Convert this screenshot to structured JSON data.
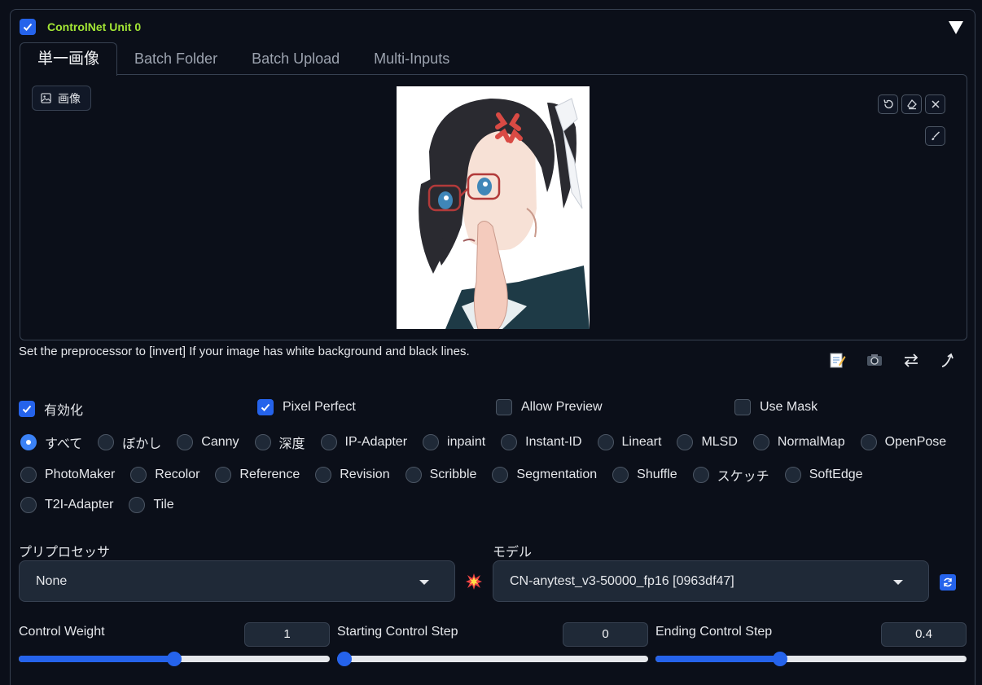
{
  "unit": {
    "title": "ControlNet Unit 0",
    "enabled": true
  },
  "tabs": [
    {
      "label": "単一画像",
      "active": true
    },
    {
      "label": "Batch Folder",
      "active": false
    },
    {
      "label": "Batch Upload",
      "active": false
    },
    {
      "label": "Multi-Inputs",
      "active": false
    }
  ],
  "image_panel": {
    "label": "画像",
    "image_icon": "image-icon"
  },
  "hint": "Set the preprocessor to [invert] If your image has white background and black lines.",
  "options": {
    "enable": {
      "label": "有効化",
      "checked": true
    },
    "pixel_perfect": {
      "label": "Pixel Perfect",
      "checked": true
    },
    "allow_preview": {
      "label": "Allow Preview",
      "checked": false
    },
    "use_mask": {
      "label": "Use Mask",
      "checked": false
    }
  },
  "control_types": [
    [
      "すべて",
      "ぼかし",
      "Canny",
      "深度",
      "IP-Adapter",
      "inpaint",
      "Instant-ID",
      "Lineart",
      "MLSD",
      "NormalMap",
      "OpenPose"
    ],
    [
      "PhotoMaker",
      "Recolor",
      "Reference",
      "Revision",
      "Scribble",
      "Segmentation",
      "Shuffle",
      "スケッチ",
      "SoftEdge"
    ],
    [
      "T2I-Adapter",
      "Tile"
    ]
  ],
  "selected_control_type": "すべて",
  "preprocessor": {
    "label": "プリプロセッサ",
    "value": "None"
  },
  "model": {
    "label": "モデル",
    "value": "CN-anytest_v3-50000_fp16 [0963df47]"
  },
  "sliders": {
    "control_weight": {
      "label": "Control Weight",
      "value": "1",
      "fraction": 0.5
    },
    "starting_step": {
      "label": "Starting Control Step",
      "value": "0",
      "fraction": 0.0
    },
    "ending_step": {
      "label": "Ending Control Step",
      "value": "0.4",
      "fraction": 0.4
    }
  },
  "colors": {
    "accent": "#2563eb",
    "title": "#a3e635",
    "background": "#0b0f19"
  }
}
